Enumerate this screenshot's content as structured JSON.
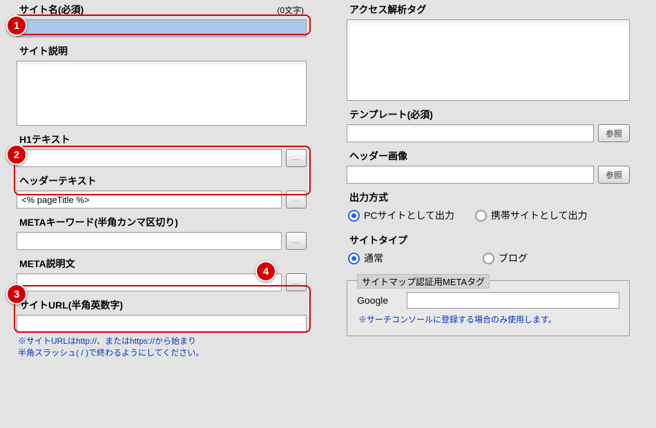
{
  "left": {
    "site_name": {
      "label": "サイト名(必須)",
      "counter": "(0文字)",
      "value": ""
    },
    "site_desc": {
      "label": "サイト説明",
      "value": ""
    },
    "h1_text": {
      "label": "H1テキスト",
      "value": ""
    },
    "header_text": {
      "label": "ヘッダーテキスト",
      "value": "<% pageTitle %>"
    },
    "meta_keywords": {
      "label": "METAキーワード(半角カンマ区切り)",
      "value": ""
    },
    "meta_desc": {
      "label": "META説明文",
      "value": ""
    },
    "site_url": {
      "label": "サイトURL(半角英数字)",
      "value": "",
      "note1": "※サイトURLはhttp://、またはhttps://から始まり",
      "note2": "半角スラッシュ( / )で終わるようにしてください。"
    },
    "dots": "..."
  },
  "right": {
    "analytics": {
      "label": "アクセス解析タグ",
      "value": ""
    },
    "template": {
      "label": "テンプレート(必須)",
      "value": "",
      "browse": "参照"
    },
    "header_image": {
      "label": "ヘッダー画像",
      "value": "",
      "browse": "参照"
    },
    "output": {
      "label": "出力方式",
      "opt1": "PCサイトとして出力",
      "opt2": "携帯サイトとして出力",
      "selected": "opt1"
    },
    "site_type": {
      "label": "サイトタイプ",
      "opt1": "通常",
      "opt2": "ブログ",
      "selected": "opt1"
    },
    "sitemap": {
      "legend": "サイトマップ認証用METAタグ",
      "google_label": "Google",
      "google_value": "",
      "note": "※サーチコンソールに登録する場合のみ使用します。"
    }
  },
  "badges": {
    "b1": "1",
    "b2": "2",
    "b3": "3",
    "b4": "4"
  }
}
